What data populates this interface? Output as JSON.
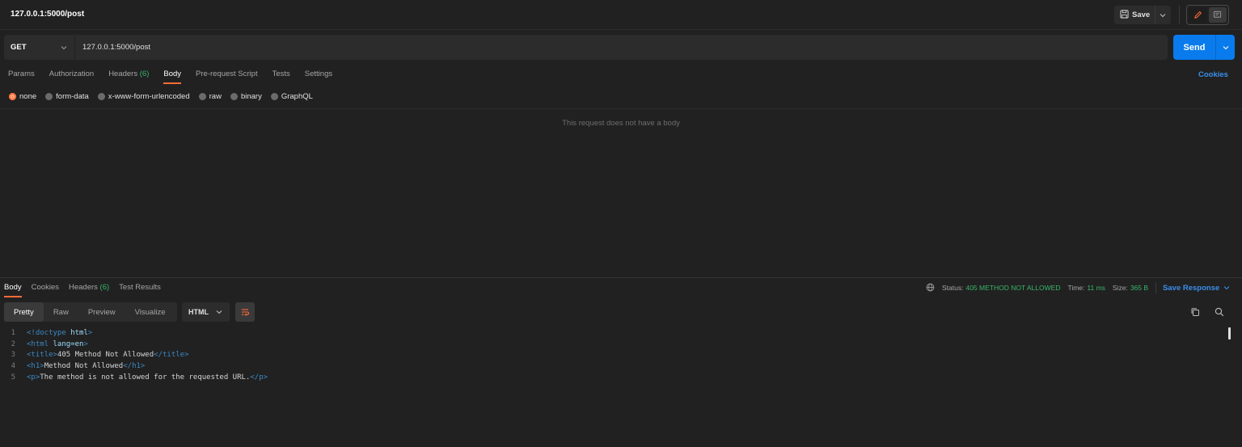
{
  "title_bar": {
    "title": "127.0.0.1:5000/post",
    "save_label": "Save"
  },
  "request": {
    "method": "GET",
    "url": "127.0.0.1:5000/post",
    "send_label": "Send",
    "tabs": [
      {
        "label": "Params",
        "count": ""
      },
      {
        "label": "Authorization",
        "count": ""
      },
      {
        "label": "Headers",
        "count": "(6)"
      },
      {
        "label": "Body",
        "count": "",
        "active": true
      },
      {
        "label": "Pre-request Script",
        "count": ""
      },
      {
        "label": "Tests",
        "count": ""
      },
      {
        "label": "Settings",
        "count": ""
      }
    ],
    "cookies_label": "Cookies",
    "body_types": [
      "none",
      "form-data",
      "x-www-form-urlencoded",
      "raw",
      "binary",
      "GraphQL"
    ],
    "selected_body_type": "none",
    "empty_body_message": "This request does not have a body"
  },
  "response": {
    "tabs": [
      {
        "label": "Body",
        "count": "",
        "active": true
      },
      {
        "label": "Cookies",
        "count": ""
      },
      {
        "label": "Headers",
        "count": "(6)"
      },
      {
        "label": "Test Results",
        "count": ""
      }
    ],
    "status_label": "Status:",
    "status_value": "405 METHOD NOT ALLOWED",
    "time_label": "Time:",
    "time_value": "11 ms",
    "size_label": "Size:",
    "size_value": "365 B",
    "save_response_label": "Save Response",
    "view_modes": [
      "Pretty",
      "Raw",
      "Preview",
      "Visualize"
    ],
    "active_view_mode": "Pretty",
    "format": "HTML",
    "code_lines": [
      {
        "n": "1",
        "text": "<!doctype html>"
      },
      {
        "n": "2",
        "text": "<html lang=en>"
      },
      {
        "n": "3",
        "text": "<title>405 Method Not Allowed</title>"
      },
      {
        "n": "4",
        "text": "<h1>Method Not Allowed</h1>"
      },
      {
        "n": "5",
        "text": "<p>The method is not allowed for the requested URL.</p>"
      }
    ]
  },
  "colors": {
    "accent": "#ff6c37",
    "send": "#097bed",
    "link": "#3a8eea",
    "success": "#39b56a",
    "background": "#212121"
  },
  "icons": [
    "save-icon",
    "chevron-down-icon",
    "pencil-icon",
    "comment-icon",
    "globe-icon",
    "wrap-lines-icon",
    "copy-icon",
    "search-icon"
  ]
}
